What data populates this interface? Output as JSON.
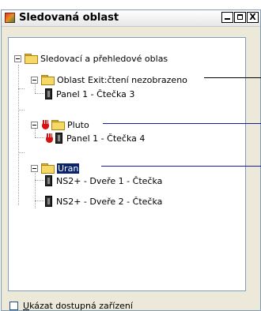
{
  "window": {
    "title": "Sledovaná oblast",
    "buttons": {
      "minimize": "_",
      "maximize": "□",
      "close": "X"
    }
  },
  "tree": {
    "root": "Sledovací a přehledové oblas",
    "n1": "Oblast Exit:čtení nezobrazeno",
    "n1_child": "Panel 1 - Čtečka 3",
    "n2": "Pluto",
    "n2_child": "Panel 1 - Čtečka 4",
    "n3": "Uran",
    "n3_child1": "NS2+ - Dveře 1 - Čtečka",
    "n3_child2": "NS2+ - Dveře 2 - Čtečka"
  },
  "checkbox": {
    "accel": "U",
    "rest": "kázat dostupná zařízení",
    "checked": false
  },
  "colors": {
    "selection": "#0a246a",
    "alarm_hand": "#d81010",
    "folder": "#f6d865"
  }
}
